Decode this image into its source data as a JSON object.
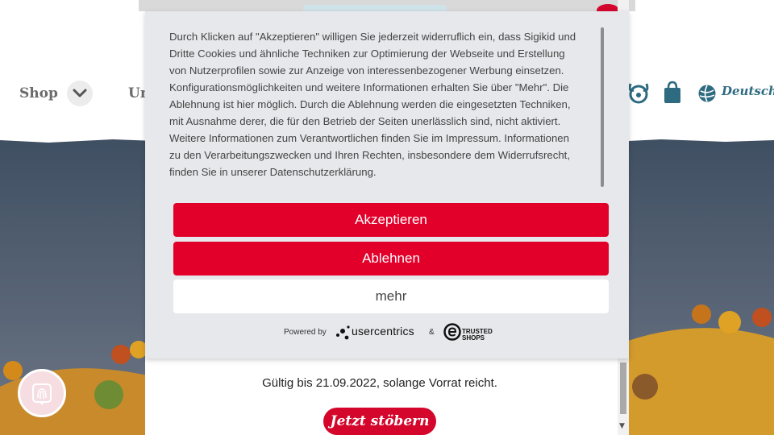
{
  "header": {
    "nav_shop": "Shop",
    "nav_partial": "Un",
    "language": "Deutsch"
  },
  "consent": {
    "text": "Durch Klicken auf \"Akzeptieren\" willigen Sie jederzeit widerruflich ein, dass Sigikid und Dritte Cookies und ähnliche Techniken zur Optimierung der Webseite und Erstellung von Nutzerprofilen sowie zur Anzeige von interessenbezogener Werbung einsetzen. Konfigurationsmöglichkeiten und weitere Informationen erhalten Sie über \"Mehr\". Die Ablehnung ist hier möglich. Durch die Ablehnung werden die eingesetzten Techniken, mit Ausnahme derer, die für den Betrieb der Seiten unerlässlich sind, nicht aktiviert. Weitere Informationen zum Verantwortlichen finden Sie im Impressum. Informationen zu den Verarbeitungszwecken und Ihren Rechten, insbesondere dem Widerrufsrecht, finden Sie in unserer Datenschutzerklärung.",
    "accept_label": "Akzeptieren",
    "decline_label": "Ablehnen",
    "more_label": "mehr",
    "powered_by": "Powered by",
    "provider": "usercentrics",
    "ampersand": "&",
    "trusted_line1": "TRUSTED",
    "trusted_line2": "SHOPS"
  },
  "promo": {
    "validity": "Gültig bis 21.09.2022, solange Vorrat reicht.",
    "cta_label": "Jetzt stöbern"
  },
  "colors": {
    "accent_red": "#e2002a",
    "dialog_bg": "#e7e8ec",
    "icon_teal": "#2e6b80"
  },
  "icons": [
    "chevron-down-icon",
    "bunny-icon",
    "shopping-bag-icon",
    "globe-icon",
    "fingerprint-icon",
    "usercentrics-logo",
    "trusted-shops-logo"
  ]
}
